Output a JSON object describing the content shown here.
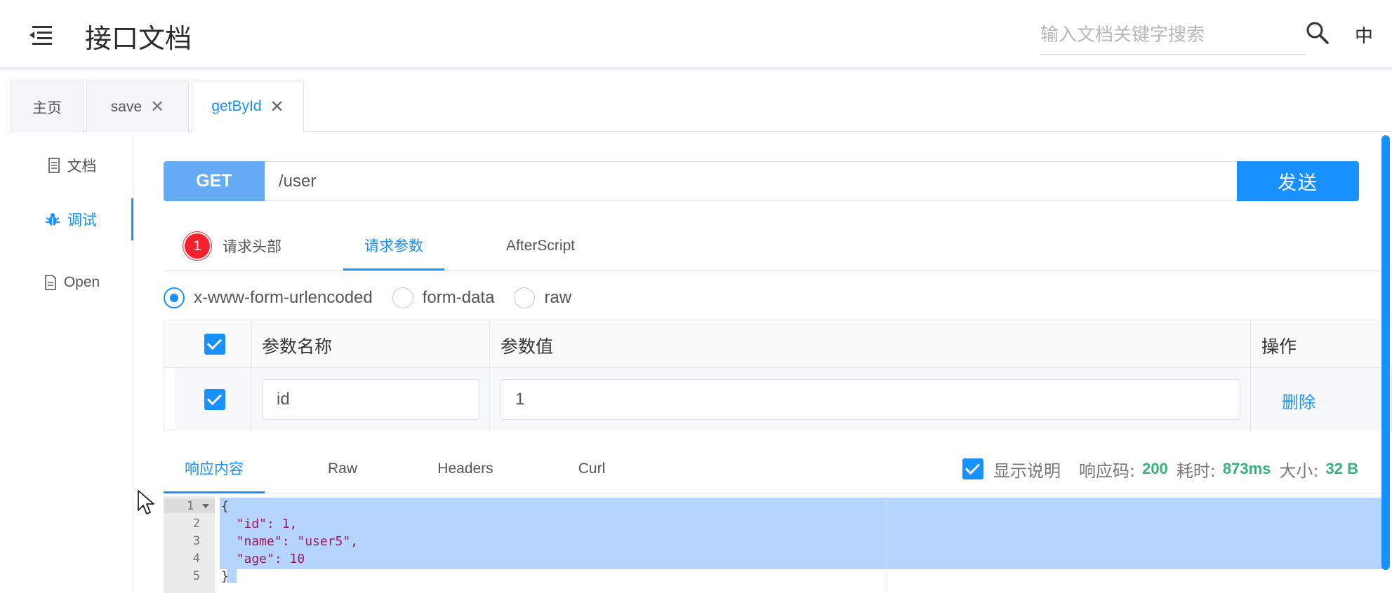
{
  "header": {
    "title": "接口文档",
    "search_placeholder": "输入文档关键字搜索",
    "lang": "中"
  },
  "tabs": [
    {
      "label": "主页",
      "closable": false,
      "active": false
    },
    {
      "label": "save",
      "closable": true,
      "active": false
    },
    {
      "label": "getById",
      "closable": true,
      "active": true
    }
  ],
  "sidebar": {
    "items": [
      {
        "label": "文档",
        "icon": "document-icon",
        "active": false
      },
      {
        "label": "调试",
        "icon": "bug-icon",
        "active": true
      },
      {
        "label": "Open",
        "icon": "file-text-icon",
        "active": false
      }
    ]
  },
  "request": {
    "method": "GET",
    "url": "/user",
    "send_label": "发送"
  },
  "request_tabs": {
    "headers_badge": "1",
    "headers_label": "请求头部",
    "params_label": "请求参数",
    "afterscript_label": "AfterScript"
  },
  "body_types": {
    "urlencoded": "x-www-form-urlencoded",
    "formdata": "form-data",
    "raw": "raw",
    "selected": "x-www-form-urlencoded"
  },
  "params_table": {
    "col_name": "参数名称",
    "col_value": "参数值",
    "col_action": "操作",
    "rows": [
      {
        "checked": true,
        "name": "id",
        "value": "1",
        "action": "删除"
      }
    ]
  },
  "response_tabs": {
    "content": "响应内容",
    "raw": "Raw",
    "headers": "Headers",
    "curl": "Curl"
  },
  "response_meta": {
    "show_desc_label": "显示说明",
    "show_desc_checked": true,
    "status_label": "响应码:",
    "status_value": "200",
    "time_label": "耗时:",
    "time_value": "873ms",
    "size_label": "大小:",
    "size_value": "32 B"
  },
  "response_body": {
    "line_numbers": [
      "1",
      "2",
      "3",
      "4",
      "5"
    ],
    "lines": [
      "{",
      "  \"id\": 1,",
      "  \"name\": \"user5\",",
      "  \"age\": 10",
      "}"
    ]
  },
  "colors": {
    "primary": "#1890ff",
    "method_bg": "#64aaf5",
    "success": "#35b379",
    "badge": "#f5222d"
  }
}
